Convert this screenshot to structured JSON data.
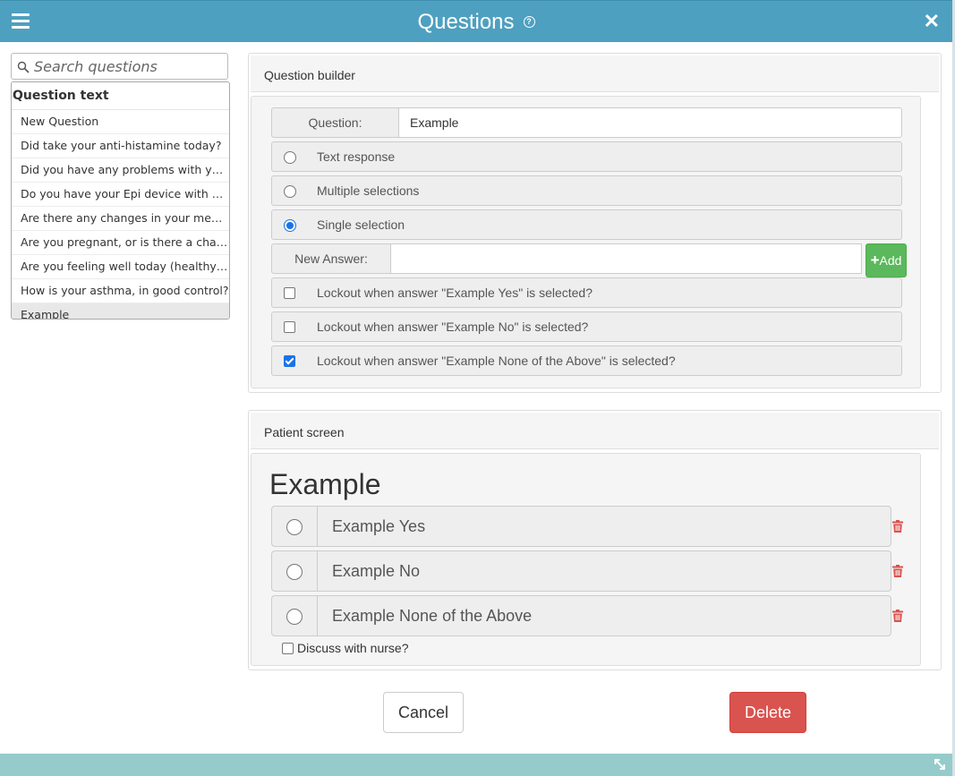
{
  "header": {
    "title": "Questions",
    "help_icon": "question-circle-icon",
    "menu_icon": "hamburger-menu-icon",
    "close_icon": "close-x-icon"
  },
  "sidebar": {
    "search_placeholder": "Search questions",
    "list_header": "Question text",
    "items": [
      "New Question",
      "Did take your anti-histamine today?",
      "Did you have any problems with your last injection?",
      "Do you have your Epi device with you?",
      "Are there any changes in your medications?",
      "Are you pregnant, or is there a chance you may be?",
      "Are you feeling well today (healthy, no fever)?",
      "How is your asthma, in good control?",
      "Example"
    ],
    "selected": "Example"
  },
  "builder": {
    "heading": "Question builder",
    "question_label": "Question:",
    "question_value": "Example",
    "types": [
      {
        "label": "Text response",
        "selected": false
      },
      {
        "label": "Multiple selections",
        "selected": false
      },
      {
        "label": "Single selection",
        "selected": true
      }
    ],
    "new_answer_label": "New Answer:",
    "new_answer_value": "",
    "add_label": "Add",
    "lockouts": [
      {
        "label": "Lockout when answer \"Example Yes\" is selected?",
        "checked": false
      },
      {
        "label": "Lockout when answer \"Example No\" is selected?",
        "checked": false
      },
      {
        "label": "Lockout when answer \"Example None of the Above\" is selected?",
        "checked": true
      }
    ]
  },
  "patient": {
    "heading": "Patient screen",
    "question_title": "Example",
    "answers": [
      "Example Yes",
      "Example No",
      "Example None of the Above"
    ],
    "discuss_label": "Discuss with nurse?"
  },
  "actions": {
    "cancel": "Cancel",
    "delete": "Delete"
  },
  "colors": {
    "header": "#4ea0c0",
    "footer": "#96cbcb",
    "add": "#5cb85c",
    "delete": "#d9534f",
    "trash": "#d9534f",
    "radio_selected": "#1a73e8"
  }
}
